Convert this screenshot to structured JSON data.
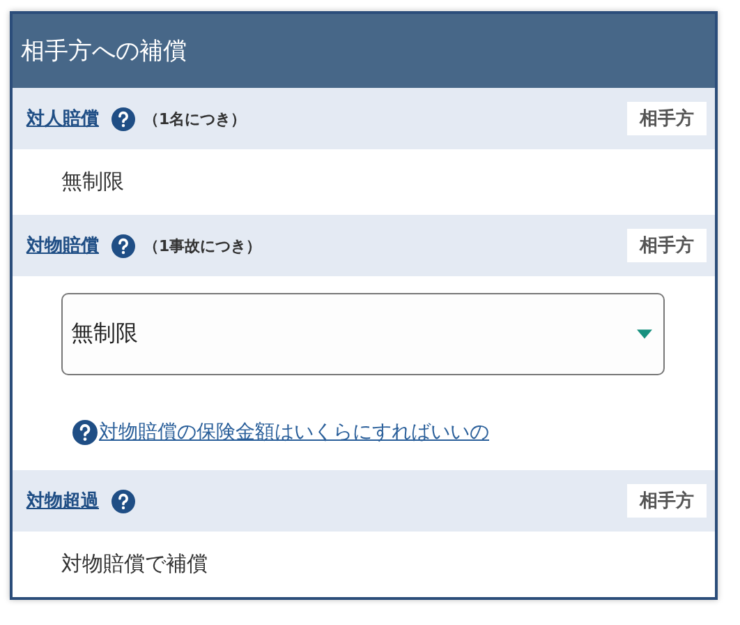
{
  "panel": {
    "title": "相手方への補償"
  },
  "sections": [
    {
      "label": "対人賠償",
      "note": "（1名につき）",
      "badge": "相手方",
      "kind": "text",
      "value": "無制限"
    },
    {
      "label": "対物賠償",
      "note": "（1事故につき）",
      "badge": "相手方",
      "kind": "select",
      "value": "無制限",
      "help_link": "対物賠償の保険金額はいくらにすればいいの"
    },
    {
      "label": "対物超過",
      "badge": "相手方",
      "kind": "text",
      "value": "対物賠償で補償"
    }
  ]
}
